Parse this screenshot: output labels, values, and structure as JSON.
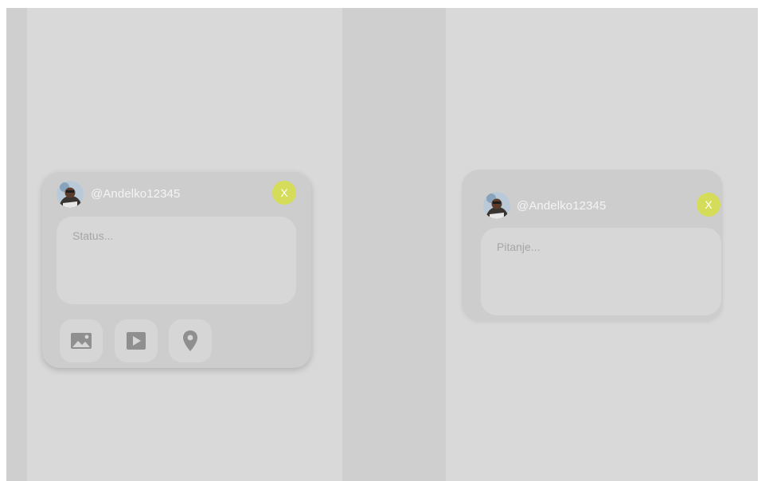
{
  "status_card": {
    "username": "@Andelko12345",
    "close_label": "X",
    "placeholder": "Status...",
    "media_buttons": [
      {
        "icon": "image-icon"
      },
      {
        "icon": "video-icon"
      },
      {
        "icon": "location-icon"
      }
    ]
  },
  "question_card": {
    "username": "@Andelko12345",
    "close_label": "X",
    "placeholder": "Pitanje..."
  },
  "colors": {
    "close_button": "#d4dc5a",
    "card": "#cdcdcd",
    "background": "#d9d9d9"
  }
}
